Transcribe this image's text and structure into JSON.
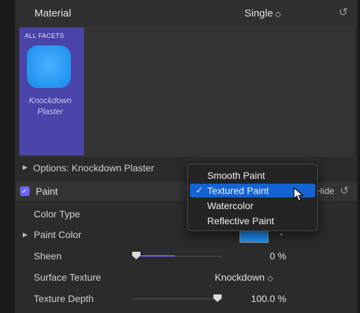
{
  "header": {
    "title": "Material",
    "mode": "Single",
    "mode_chevron": "◇",
    "reset_icon": "undo-icon"
  },
  "facet": {
    "label": "ALL FACETS",
    "name": "Knockdown Plaster",
    "swatch_color": "#2b9cf5"
  },
  "options": {
    "label": "Options: Knockdown Plaster"
  },
  "paint": {
    "label": "Paint",
    "checked": true,
    "hide_label": "Hide"
  },
  "rows": {
    "color_type": "Color Type",
    "paint_color": "Paint Color",
    "paint_color_value": "#1e8ef0",
    "sheen": "Sheen",
    "sheen_value": "0 %",
    "sheen_fraction": 0.0,
    "surface_texture": "Surface Texture",
    "surface_texture_value": "Knockdown",
    "texture_depth": "Texture Depth",
    "texture_depth_value": "100.0 %",
    "texture_depth_fraction": 1.0
  },
  "menu": {
    "items": [
      {
        "label": "Smooth Paint",
        "selected": false
      },
      {
        "label": "Textured Paint",
        "selected": true
      },
      {
        "label": "Watercolor",
        "selected": false
      },
      {
        "label": "Reflective Paint",
        "selected": false
      }
    ],
    "check_glyph": "✓"
  },
  "colors": {
    "accent": "#6c63ff",
    "menu_highlight": "#1363d4",
    "facet_bg": "#4a43a8"
  }
}
